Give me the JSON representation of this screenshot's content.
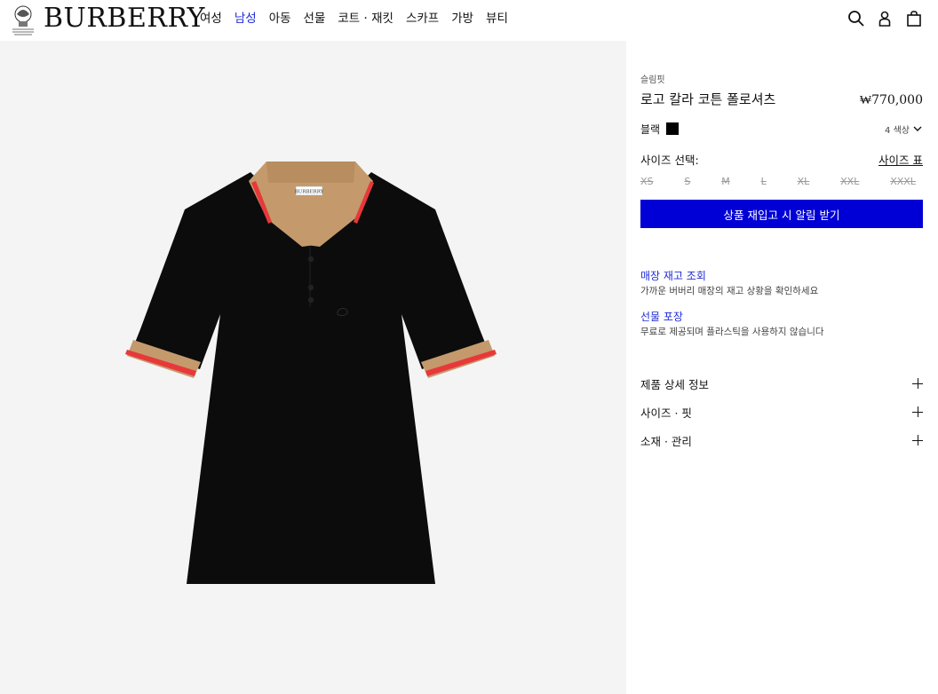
{
  "header": {
    "logo": "BURBERRY",
    "nav": [
      "여성",
      "남성",
      "아동",
      "선물",
      "코트 · 재킷",
      "스카프",
      "가방",
      "뷰티"
    ],
    "active_nav_index": 1,
    "icons": [
      "search-icon",
      "account-icon",
      "shopping-bag-icon"
    ]
  },
  "product": {
    "fit": "슬림핏",
    "title": "로고 칼라 코튼 폴로셔츠",
    "price": "₩770,000",
    "color_name": "블랙",
    "color_hex": "#000000",
    "color_count": "4 색상",
    "size_label": "사이즈 선택:",
    "size_guide": "사이즈 표",
    "sizes": [
      "XS",
      "S",
      "M",
      "L",
      "XL",
      "XXL",
      "XXXL"
    ],
    "notify_button": "상품 재입고 시 알림 받기",
    "store_stock_title": "매장 재고 조회",
    "store_stock_desc": "가까운 버버리 매장의 재고 상황을 확인하세요",
    "gift_title": "선물 포장",
    "gift_desc": "무료로 제공되며 플라스틱을 사용하지 않습니다",
    "accordions": [
      "제품 상세 정보",
      "사이즈 · 핏",
      "소재 · 관리"
    ],
    "collar_label": "BURBERRY"
  },
  "colors": {
    "accent_blue": "#0000d6",
    "link_blue": "#1f2bd6",
    "image_bg": "#f4f4f4",
    "shirt": "#0c0c0c",
    "collar_beige": "#c49a6c",
    "stripe_red": "#e8383a"
  }
}
